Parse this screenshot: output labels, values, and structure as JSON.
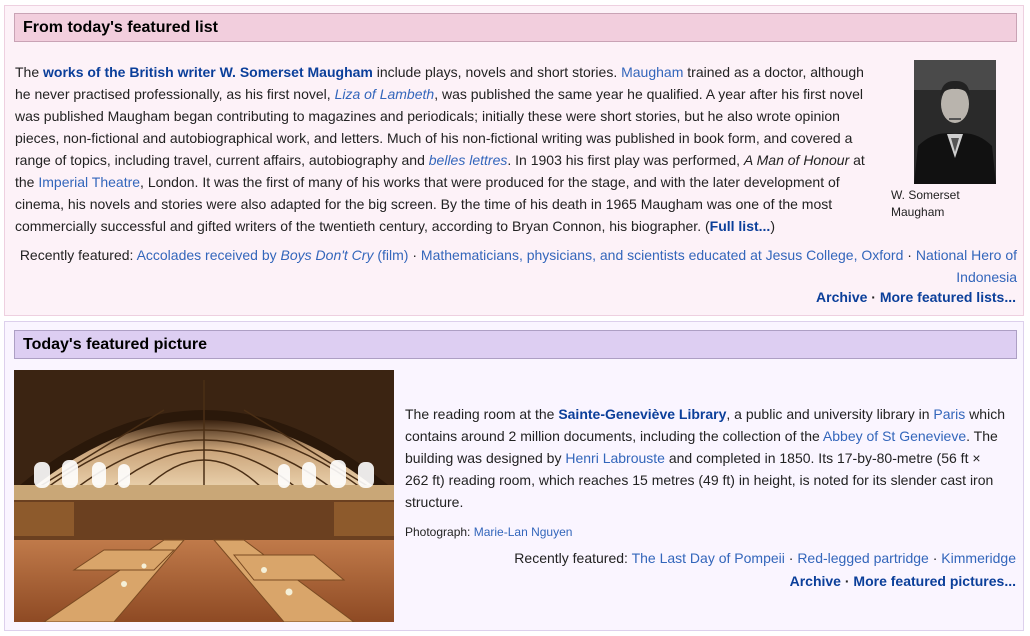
{
  "featured_list": {
    "heading": "From today's featured list",
    "p": [
      "The ",
      "works of the British writer W. Somerset Maugham",
      " include plays, novels and short stories. ",
      "Maugham",
      " trained as a doctor, although he never practised professionally, as his first novel, ",
      "Liza of Lambeth",
      ", was published the same year he qualified. A year after his first novel was published Maugham began contributing to magazines and periodicals; initially these were short stories, but he also wrote opinion pieces, non-fictional and autobiographical work, and letters. Much of his non-fictional writing was published in book form, and covered a range of topics, including travel, current affairs, autobiography and ",
      "belles lettres",
      ". In 1903 his first play was performed, ",
      "A Man of Honour",
      " at the ",
      "Imperial Theatre",
      ", London. It was the first of many of his works that were produced for the stage, and with the later development of cinema, his novels and stories were also adapted for the big screen. By the time of his death in 1965 Maugham was one of the most commercially successful and gifted writers of the twentieth century, according to Bryan Connon, his biographer. (",
      "Full list...",
      ")"
    ],
    "image_caption": "W. Somerset Maugham",
    "recently_label": "Recently featured: ",
    "recent": [
      "Accolades received by ",
      "Boys Don't Cry",
      " (film)",
      "Mathematicians, physicians, and scientists educated at Jesus College, Oxford",
      "National Hero of Indonesia"
    ],
    "archive": "Archive",
    "more": "More featured lists..."
  },
  "featured_picture": {
    "heading": "Today's featured picture",
    "p": [
      "The reading room at the ",
      "Sainte-Geneviève Library",
      ", a public and university library in ",
      "Paris",
      " which contains around 2 million documents, including the collection of the ",
      "Abbey of St Genevieve",
      ". The building was designed by ",
      "Henri Labrouste",
      " and completed in 1850. Its 17-by-80-metre (56 ft × 262 ft) reading room, which reaches 15 metres (49 ft) in height, is noted for its slender cast iron structure."
    ],
    "credit_label": "Photograph: ",
    "credit_name": "Marie-Lan Nguyen",
    "recently_label": "Recently featured: ",
    "recent": [
      "The Last Day of Pompeii",
      "Red-legged partridge",
      "Kimmeridge"
    ],
    "archive": "Archive",
    "more": "More featured pictures..."
  },
  "separator": " · "
}
